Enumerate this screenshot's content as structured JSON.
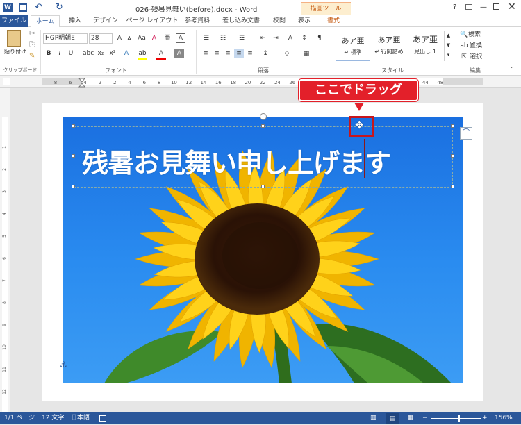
{
  "titlebar": {
    "title": "026-残暑見舞い(before).docx - Word",
    "contextual_tab": "描画ツール",
    "help": "?"
  },
  "tabs": [
    {
      "label": "ファイル"
    },
    {
      "label": "ホーム"
    },
    {
      "label": "挿入"
    },
    {
      "label": "デザイン"
    },
    {
      "label": "ページ レイアウト"
    },
    {
      "label": "参考資料"
    },
    {
      "label": "差し込み文書"
    },
    {
      "label": "校閲"
    },
    {
      "label": "表示"
    },
    {
      "label": "書式"
    }
  ],
  "ribbon": {
    "clipboard": {
      "paste_label": "貼り付け",
      "group_label": "クリップボード"
    },
    "font": {
      "name": "HGP明朝E",
      "size": "28",
      "group_label": "フォント"
    },
    "paragraph": {
      "group_label": "段落"
    },
    "styles": {
      "items": [
        {
          "preview": "あア亜",
          "label": "↵ 標準"
        },
        {
          "preview": "あア亜",
          "label": "↵ 行間詰め"
        },
        {
          "preview": "あア亜",
          "label": "見出し 1"
        }
      ],
      "group_label": "スタイル"
    },
    "editing": {
      "find": "検索",
      "replace": "置換",
      "select": "選択",
      "group_label": "編集"
    }
  },
  "ruler": {
    "h_ticks": [
      "8",
      "6",
      "4",
      "2",
      "2",
      "4",
      "6",
      "8",
      "10",
      "12",
      "14",
      "16",
      "18",
      "20",
      "22",
      "24",
      "26",
      "28",
      "30",
      "32",
      "34",
      "36",
      "38",
      "40",
      "42",
      "44",
      "48"
    ],
    "v_ticks": [
      "1",
      "2",
      "3",
      "4",
      "5",
      "6",
      "7",
      "8",
      "9",
      "10",
      "11",
      "12",
      "13",
      "14"
    ]
  },
  "document": {
    "heading": "残暑お見舞い申し上げます",
    "callout": "ここでドラッグ"
  },
  "statusbar": {
    "page": "1/1 ページ",
    "words": "12 文字",
    "lang": "日本語",
    "zoom": "156%"
  },
  "colors": {
    "accent": "#2b579a",
    "callout": "#e3202a",
    "sky": "#2a8cf0"
  }
}
